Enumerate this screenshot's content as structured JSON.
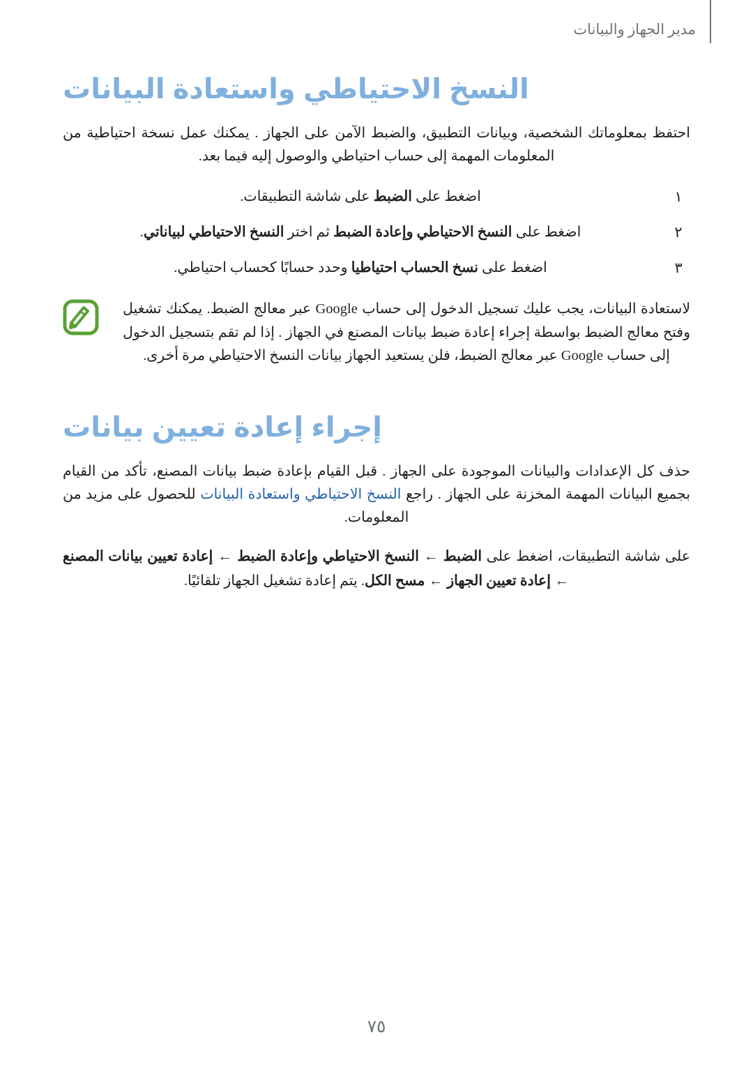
{
  "header": {
    "running_title": "مدير الجهاز والبيانات",
    "rule_color": "#6e7577"
  },
  "colors": {
    "heading_blue": "#7FB0DE",
    "link_blue": "#2463AC",
    "note_icon_green": "#5BA136",
    "body_text": "#231f20",
    "header_gray": "#6e7577"
  },
  "sections": [
    {
      "title": "النسخ الاحتياطي واستعادة البيانات",
      "intro": "احتفظ بمعلوماتك الشخصية، وبيانات التطبيق، والضبط الآمن على الجهاز . يمكنك عمل نسخة احتياطية من المعلومات المهمة إلى حساب احتياطي والوصول إليه فيما بعد.",
      "steps": [
        {
          "marker": "١",
          "parts": [
            {
              "text": "اضغط على ",
              "bold": false
            },
            {
              "text": "الضبط",
              "bold": true
            },
            {
              "text": " على شاشة التطبيقات.",
              "bold": false
            }
          ]
        },
        {
          "marker": "٢",
          "parts": [
            {
              "text": "اضغط على ",
              "bold": false
            },
            {
              "text": "النسخ الاحتياطي وإعادة الضبط",
              "bold": true
            },
            {
              "text": " ثم اختر ",
              "bold": false
            },
            {
              "text": "النسخ الاحتياطي لبياناتي",
              "bold": true
            },
            {
              "text": ".",
              "bold": false
            }
          ]
        },
        {
          "marker": "٣",
          "parts": [
            {
              "text": "اضغط على ",
              "bold": false
            },
            {
              "text": "نسخ الحساب احتياطيا",
              "bold": true
            },
            {
              "text": " وحدد حسابًا كحساب احتياطي.",
              "bold": false
            }
          ]
        }
      ],
      "note": {
        "icon": "note-pencil-icon",
        "text": "لاستعادة البيانات، يجب عليك تسجيل الدخول إلى حساب Google عبر معالج الضبط. يمكنك تشغيل وفتح معالج الضبط بواسطة إجراء إعادة ضبط بيانات المصنع في الجهاز . إذا لم تقم بتسجيل الدخول إلى حساب Google عبر معالج الضبط، فلن يستعيد الجهاز بيانات النسخ الاحتياطي مرة أخرى."
      }
    },
    {
      "title": "إجراء إعادة تعيين بيانات",
      "paragraph_parts": [
        {
          "text": "حذف كل الإعدادات والبيانات الموجودة على الجهاز . قبل القيام بإعادة ضبط بيانات المصنع، تأكد من القيام بجميع البيانات المهمة المخزنة على الجهاز . راجع ",
          "style": "normal"
        },
        {
          "text": "النسخ الاحتياطي واستعادة البيانات",
          "style": "link"
        },
        {
          "text": " للحصول على مزيد من المعلومات.",
          "style": "normal"
        }
      ],
      "instruction_parts": [
        {
          "text": "على شاشة التطبيقات، اضغط على ",
          "bold": false
        },
        {
          "text": "الضبط",
          "bold": true
        },
        {
          "text": " ← ",
          "bold": false,
          "arrow": true
        },
        {
          "text": "النسخ الاحتياطي وإعادة الضبط",
          "bold": true
        },
        {
          "text": " ← ",
          "bold": false,
          "arrow": true
        },
        {
          "text": "إعادة تعيين بيانات المصنع",
          "bold": true
        },
        {
          "text": " ← ",
          "bold": false,
          "arrow": true
        },
        {
          "text": "إعادة تعيين الجهاز",
          "bold": true
        },
        {
          "text": " ← ",
          "bold": false,
          "arrow": true
        },
        {
          "text": "مسح الكل",
          "bold": true
        },
        {
          "text": ". يتم إعادة تشغيل الجهاز تلقائيًا.",
          "bold": false
        }
      ]
    }
  ],
  "footer": {
    "page_number": "٧٥"
  }
}
